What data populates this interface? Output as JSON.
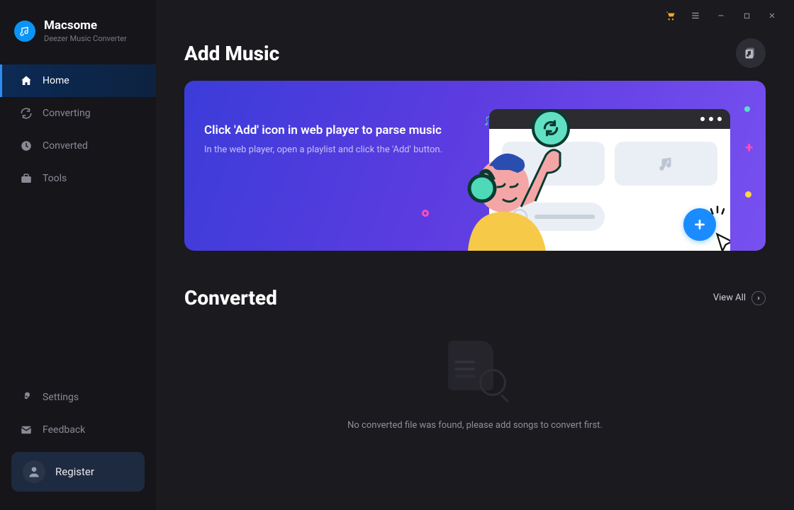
{
  "brand": {
    "name": "Macsome",
    "subtitle": "Deezer Music Converter"
  },
  "sidebar": {
    "items": [
      {
        "label": "Home",
        "icon": "home-icon",
        "active": true
      },
      {
        "label": "Converting",
        "icon": "converting-icon",
        "active": false
      },
      {
        "label": "Converted",
        "icon": "converted-icon",
        "active": false
      },
      {
        "label": "Tools",
        "icon": "tools-icon",
        "active": false
      }
    ],
    "bottom": [
      {
        "label": "Settings",
        "icon": "settings-icon"
      },
      {
        "label": "Feedback",
        "icon": "feedback-icon"
      }
    ],
    "register": {
      "label": "Register"
    }
  },
  "sections": {
    "add_music": {
      "title": "Add Music",
      "banner_title": "Click 'Add' icon in web player to parse music",
      "banner_sub": "In the web player, open a playlist and click the 'Add' button."
    },
    "converted": {
      "title": "Converted",
      "view_all": "View All",
      "empty_text": "No converted file was found, please add songs to convert first."
    }
  }
}
